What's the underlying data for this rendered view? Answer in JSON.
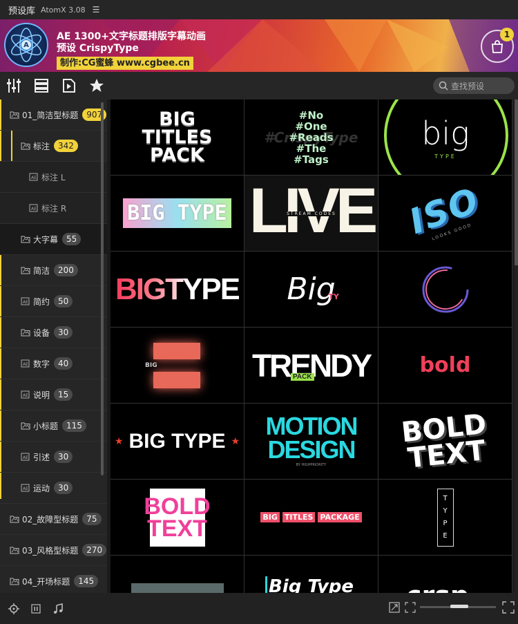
{
  "titlebar": {
    "title": "预设库",
    "version": "AtomX 3.08"
  },
  "banner": {
    "title_line1": "AE 1300+文字标题排版字幕动画",
    "title_line2": "预设 CrispyType",
    "credit": "制作:CG蜜蜂 www.cgbee.cn",
    "cart_count": "1"
  },
  "search": {
    "placeholder": "查找预设"
  },
  "sidebar": {
    "items": [
      {
        "label": "01_简洁型标题",
        "count": "907",
        "level": 0,
        "badge": "yellow"
      },
      {
        "label": "标注",
        "count": "342",
        "level": 1,
        "badge": "yellow"
      },
      {
        "label": "标注 L",
        "count": "",
        "level": 2,
        "type": "ae"
      },
      {
        "label": "标注 R",
        "count": "",
        "level": 2,
        "type": "ae"
      },
      {
        "label": "大字幕",
        "count": "55",
        "level": 1,
        "active": true
      },
      {
        "label": "简洁",
        "count": "200",
        "level": 1
      },
      {
        "label": "简约",
        "count": "50",
        "level": 1,
        "type": "ae"
      },
      {
        "label": "设备",
        "count": "30",
        "level": 1
      },
      {
        "label": "数字",
        "count": "40",
        "level": 1,
        "type": "ae"
      },
      {
        "label": "说明",
        "count": "15",
        "level": 1,
        "type": "ae"
      },
      {
        "label": "小标题",
        "count": "115",
        "level": 1
      },
      {
        "label": "引述",
        "count": "30",
        "level": 1,
        "type": "ae"
      },
      {
        "label": "运动",
        "count": "30",
        "level": 1,
        "type": "ae"
      },
      {
        "label": "02_故障型标题",
        "count": "75",
        "level": 0
      },
      {
        "label": "03_风格型标题",
        "count": "270",
        "level": 0
      },
      {
        "label": "04_开场标题",
        "count": "145",
        "level": 0
      }
    ]
  },
  "thumbnails": [
    {
      "lines": [
        "BIG",
        "TITLES",
        "PACK"
      ]
    },
    {
      "lines": [
        "#No",
        "#One",
        "#Reads",
        "#The",
        "#Tags"
      ],
      "bg_text": "#CrispyType"
    },
    {
      "lines": [
        "big",
        "TYPE"
      ]
    },
    {
      "lines": [
        "BIG TYPE"
      ]
    },
    {
      "lines": [
        "LIVE",
        "STREAM CODES"
      ]
    },
    {
      "lines": [
        "ISO",
        "LOOKS GOOD"
      ]
    },
    {
      "lines": [
        "BIGTYPE"
      ]
    },
    {
      "lines": [
        "Big",
        "TY"
      ]
    },
    {
      "lines": []
    },
    {
      "lines": [
        "BIG"
      ]
    },
    {
      "lines": [
        "TRENDY",
        "PACK"
      ]
    },
    {
      "lines": [
        "bold"
      ]
    },
    {
      "lines": [
        "BIG TYPE"
      ]
    },
    {
      "lines": [
        "MOTION",
        "DESIGN",
        "BY HIGHPRIORITY"
      ]
    },
    {
      "lines": [
        "BOLD",
        "TEXT"
      ]
    },
    {
      "lines": [
        "BOLD",
        "TEXT"
      ]
    },
    {
      "lines": [
        "BIG",
        "TITLES",
        "PACKAGE"
      ]
    },
    {
      "lines": [
        "TYPE"
      ]
    },
    {
      "lines": []
    },
    {
      "lines": [
        "Big Type"
      ]
    },
    {
      "lines": [
        "crsp"
      ]
    }
  ],
  "colors": {
    "accent": "#f1d23a",
    "panel": "#262626"
  }
}
